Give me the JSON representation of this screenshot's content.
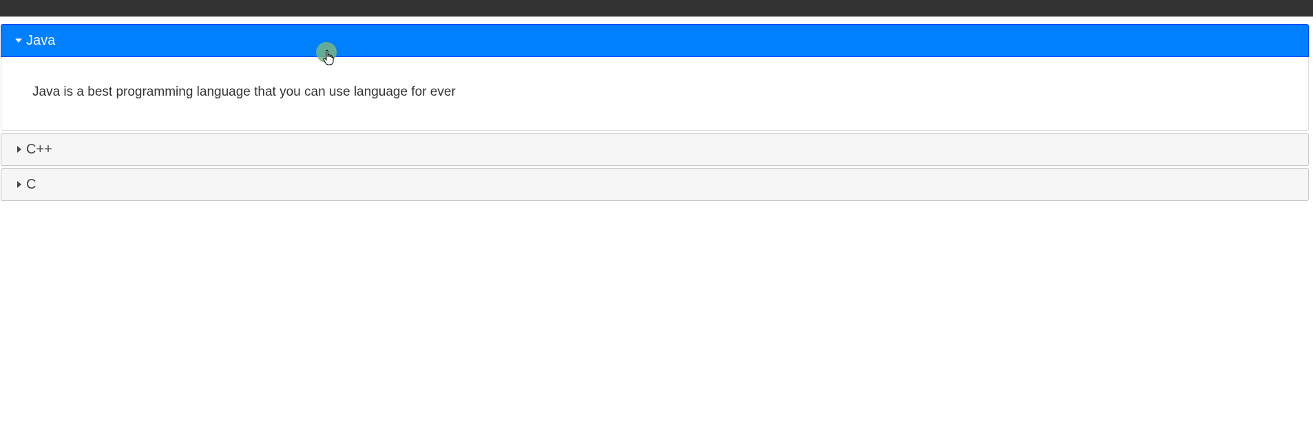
{
  "accordion": {
    "sections": [
      {
        "title": "Java",
        "expanded": true,
        "content": "Java is a best programming language that you can use language for ever"
      },
      {
        "title": "C++",
        "expanded": false
      },
      {
        "title": "C",
        "expanded": false
      }
    ]
  },
  "colors": {
    "active_header": "#007fff",
    "inactive_header": "#f6f6f6",
    "topbar": "#333333"
  },
  "icons": {
    "expanded": "caret-down-icon",
    "collapsed": "caret-right-icon",
    "pointer": "hand-cursor-icon"
  }
}
